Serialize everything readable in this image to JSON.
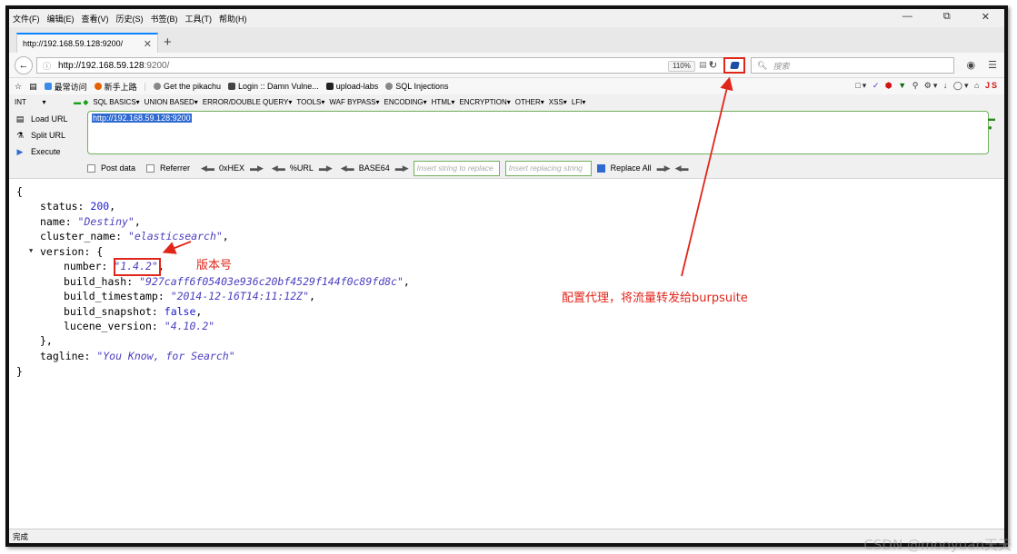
{
  "menubar": {
    "items": [
      "文件(F)",
      "编辑(E)",
      "查看(V)",
      "历史(S)",
      "书签(B)",
      "工具(T)",
      "帮助(H)"
    ]
  },
  "window_controls": {
    "minimize": "—",
    "restore": "⧉",
    "close": "✕"
  },
  "tab": {
    "title": "http://192.168.59.128:9200/",
    "close": "✕",
    "new": "+"
  },
  "address": {
    "host": "http://192.168.59.128",
    "rest": ":9200/",
    "zoom": "110%"
  },
  "search": {
    "placeholder": "搜索"
  },
  "bookmarks": [
    {
      "label": "最常访问",
      "color": "#3c8ce7"
    },
    {
      "label": "新手上路",
      "color": "#e66000"
    },
    {
      "label": "Get the pikachu",
      "color": "#888888"
    },
    {
      "label": "Login :: Damn Vulne...",
      "color": "#444444"
    },
    {
      "label": "upload-labs",
      "color": "#222222"
    },
    {
      "label": "SQL Injections",
      "color": "#888888"
    }
  ],
  "hackbar": {
    "int_select": "INT",
    "menus": [
      "SQL BASICS▾",
      "UNION BASED▾",
      "ERROR/DOUBLE QUERY▾",
      "TOOLS▾",
      "WAF BYPASS▾",
      "ENCODING▾",
      "HTML▾",
      "ENCRYPTION▾",
      "OTHER▾",
      "XSS▾",
      "LFI▾"
    ],
    "load_url": "Load URL",
    "split_url": "Split URL",
    "execute": "Execute",
    "url_value": "http://192.168.59.128:9200",
    "post_data": "Post data",
    "referrer": "Referrer",
    "hex": "0xHEX",
    "url_enc": "%URL",
    "base64": "BASE64",
    "insert_string": "Insert string to replace",
    "insert_replacing": "Insert replacing string",
    "replace_all": "Replace All"
  },
  "json": {
    "open": "{",
    "status_key": "status: ",
    "status_val": "200",
    "name_key": "name: ",
    "name_val": "\"Destiny\"",
    "cluster_key": "cluster_name: ",
    "cluster_val": "\"elasticsearch\"",
    "version_key": "version: {",
    "number_key": "number: ",
    "number_val": "\"1.4.2\"",
    "hash_key": "build_hash: ",
    "hash_val": "\"927caff6f05403e936c20bf4529f144f0c89fd8c\"",
    "ts_key": "build_timestamp: ",
    "ts_val": "\"2014-12-16T14:11:12Z\"",
    "snap_key": "build_snapshot: ",
    "snap_val": "false",
    "lucene_key": "lucene_version: ",
    "lucene_val": "\"4.10.2\"",
    "version_close": "},",
    "tagline_key": "tagline: ",
    "tagline_val": "\"You Know, for Search\"",
    "close": "}"
  },
  "annotations": {
    "version_label": "版本号",
    "proxy_label": "配置代理，将流量转发给burpsuite"
  },
  "status": {
    "text": "完成"
  },
  "watermark": "CSDN @mooyuan天天",
  "colors": {
    "annotation": "#e0261b",
    "hackbar_border": "#6fb25a",
    "tab_accent": "#0a84ff"
  }
}
